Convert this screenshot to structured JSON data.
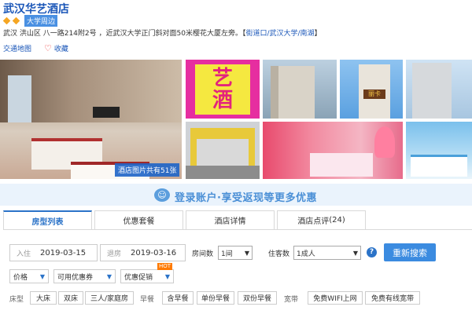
{
  "hotel": {
    "name": "武汉华艺酒店",
    "badge": "大学周边",
    "address_prefix": "武汉 洪山区 八一路214附2号 ，近武汉大学正门斜对面50米樱花大厦左旁。【",
    "address_area": "街道口/武汉大学/南湖",
    "address_suffix": "】"
  },
  "links": {
    "map": "交通地图",
    "favorite": "收藏"
  },
  "gallery": {
    "photo_count_label": "酒店图片共有51张",
    "neon_sign_chars": [
      "艺",
      "酒"
    ],
    "building_sign": "丽卡"
  },
  "banner": {
    "text": "登录账户·享受返现等更多优惠"
  },
  "tabs": [
    {
      "label": "房型列表",
      "active": true
    },
    {
      "label": "优惠套餐",
      "active": false
    },
    {
      "label": "酒店详情",
      "active": false
    },
    {
      "label": "酒店点评",
      "count": "(24)",
      "active": false
    }
  ],
  "search": {
    "checkin_label": "入住",
    "checkin_date": "2019-03-15",
    "checkout_label": "退房",
    "checkout_date": "2019-03-16",
    "rooms_label": "房间数",
    "rooms_value": "1间",
    "guests_label": "住客数",
    "guests_value": "1成人",
    "help": "?",
    "button": "重新搜索"
  },
  "filters": {
    "price": "价格",
    "coupon": "可用优惠券",
    "promo": "优惠促销",
    "hot": "HOT"
  },
  "attributes": {
    "bed_label": "床型",
    "bed_options": [
      "大床",
      "双床",
      "三人/家庭房"
    ],
    "breakfast_label": "早餐",
    "breakfast_options": [
      "含早餐",
      "单份早餐",
      "双份早餐"
    ],
    "broadband_label": "宽带",
    "broadband_options": [
      "免费WIFI上网",
      "免费有线宽带"
    ]
  },
  "colors": {
    "link": "#1a56b8",
    "accent": "#2b73c8",
    "button": "#3b8be0",
    "hot": "#ff7a00"
  }
}
